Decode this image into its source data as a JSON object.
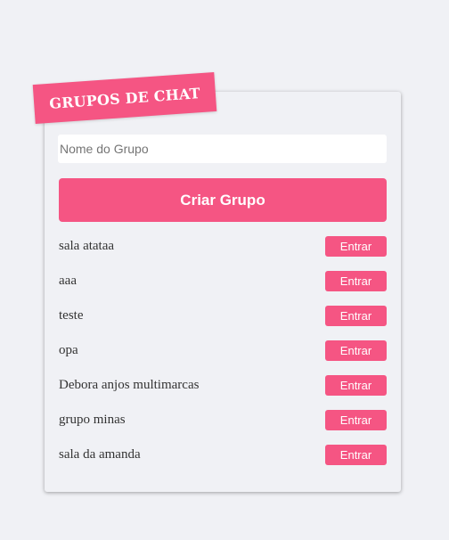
{
  "header": {
    "title": "GRUPOS DE CHAT"
  },
  "form": {
    "group_name_placeholder": "Nome do Grupo",
    "group_name_value": "",
    "create_button_label": "Criar Grupo"
  },
  "groups": [
    {
      "name": "sala atataa",
      "action_label": "Entrar"
    },
    {
      "name": "aaa",
      "action_label": "Entrar"
    },
    {
      "name": "teste",
      "action_label": "Entrar"
    },
    {
      "name": "opa",
      "action_label": "Entrar"
    },
    {
      "name": "Debora anjos multimarcas",
      "action_label": "Entrar"
    },
    {
      "name": "grupo minas",
      "action_label": "Entrar"
    },
    {
      "name": "sala da amanda",
      "action_label": "Entrar"
    }
  ],
  "colors": {
    "accent": "#f55583",
    "background": "#f0f1f5",
    "text": "#333333"
  }
}
